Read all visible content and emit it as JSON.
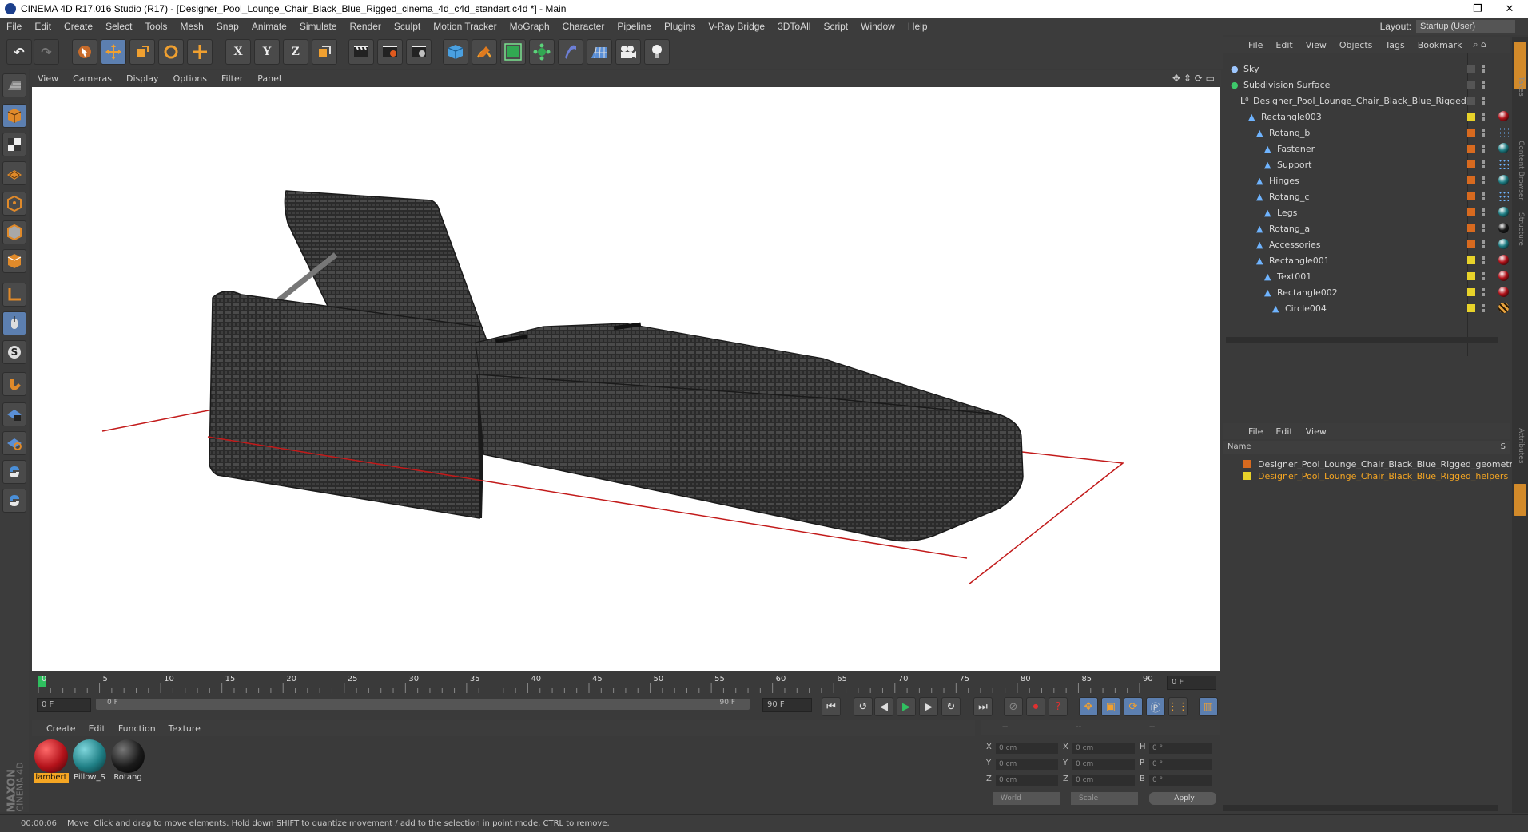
{
  "window": {
    "title": "CINEMA 4D R17.016 Studio (R17) - [Designer_Pool_Lounge_Chair_Black_Blue_Rigged_cinema_4d_c4d_standart.c4d *] - Main",
    "min_glyph": "—",
    "restore_glyph": "❐",
    "close_glyph": "✕"
  },
  "menubar": {
    "items": [
      "File",
      "Edit",
      "Create",
      "Select",
      "Tools",
      "Mesh",
      "Snap",
      "Animate",
      "Simulate",
      "Render",
      "Sculpt",
      "Motion Tracker",
      "MoGraph",
      "Character",
      "Pipeline",
      "Plugins",
      "V-Ray Bridge",
      "3DToAll",
      "Script",
      "Window",
      "Help"
    ],
    "layout_label": "Layout:",
    "layout_value": "Startup (User)"
  },
  "toolbar": {
    "undo_icon": "↶",
    "redo_icon": "↷",
    "x_label": "X",
    "y_label": "Y",
    "z_label": "Z"
  },
  "viewport_menu": {
    "items": [
      "View",
      "Cameras",
      "Display",
      "Options",
      "Filter",
      "Panel"
    ]
  },
  "timeline": {
    "ticks": [
      "0",
      "5",
      "10",
      "15",
      "20",
      "25",
      "30",
      "35",
      "40",
      "45",
      "50",
      "55",
      "60",
      "65",
      "70",
      "75",
      "80",
      "85",
      "90"
    ],
    "current_frame": "0 F",
    "start_field": "0 F",
    "range_start": "0 F",
    "range_end": "90 F",
    "end_field": "90 F"
  },
  "material_menu": {
    "items": [
      "Create",
      "Edit",
      "Function",
      "Texture"
    ]
  },
  "materials": [
    {
      "name": "lambert",
      "color": "#b3121a",
      "selected": true
    },
    {
      "name": "Pillow_S",
      "color": "#1f7f85",
      "selected": false
    },
    {
      "name": "Rotang",
      "color": "#1a1a1a",
      "selected": false
    }
  ],
  "coordinates": {
    "header": [
      "--",
      "--",
      "--"
    ],
    "rows": [
      {
        "a": "X",
        "av": "0 cm",
        "b": "X",
        "bv": "0 cm",
        "c": "H",
        "cv": "0 °"
      },
      {
        "a": "Y",
        "av": "0 cm",
        "b": "Y",
        "bv": "0 cm",
        "c": "P",
        "cv": "0 °"
      },
      {
        "a": "Z",
        "av": "0 cm",
        "b": "Z",
        "bv": "0 cm",
        "c": "B",
        "cv": "0 °"
      }
    ],
    "mode": "World",
    "type": "Scale",
    "apply": "Apply"
  },
  "object_manager": {
    "menu": [
      "File",
      "Edit",
      "View",
      "Objects",
      "Tags",
      "Bookmark"
    ],
    "objects": [
      {
        "name": "Sky",
        "level": 0,
        "layer": "",
        "tag": ""
      },
      {
        "name": "Subdivision Surface",
        "level": 0,
        "layer": "",
        "tag": ""
      },
      {
        "name": "Designer_Pool_Lounge_Chair_Black_Blue_Rigged",
        "level": 1,
        "layer": "",
        "tag": ""
      },
      {
        "name": "Rectangle003",
        "level": 2,
        "layer": "#e8d32a",
        "tag": "#b3121a"
      },
      {
        "name": "Rotang_b",
        "level": 3,
        "layer": "#d86a1f",
        "tag": "dots"
      },
      {
        "name": "Fastener",
        "level": 4,
        "layer": "#d86a1f",
        "tag": "#1f7f85"
      },
      {
        "name": "Support",
        "level": 4,
        "layer": "#d86a1f",
        "tag": "dots"
      },
      {
        "name": "Hinges",
        "level": 3,
        "layer": "#d86a1f",
        "tag": "#1f7f85"
      },
      {
        "name": "Rotang_c",
        "level": 3,
        "layer": "#d86a1f",
        "tag": "dots"
      },
      {
        "name": "Legs",
        "level": 4,
        "layer": "#d86a1f",
        "tag": "#1f7f85"
      },
      {
        "name": "Rotang_a",
        "level": 3,
        "layer": "#d86a1f",
        "tag": "#1a1a1a"
      },
      {
        "name": "Accessories",
        "level": 3,
        "layer": "#d86a1f",
        "tag": "#1f7f85"
      },
      {
        "name": "Rectangle001",
        "level": 3,
        "layer": "#e8d32a",
        "tag": "#b3121a"
      },
      {
        "name": "Text001",
        "level": 4,
        "layer": "#e8d32a",
        "tag": "#b3121a"
      },
      {
        "name": "Rectangle002",
        "level": 4,
        "layer": "#e8d32a",
        "tag": "#b3121a"
      },
      {
        "name": "Circle004",
        "level": 5,
        "layer": "#e8d32a",
        "tag": "stripe"
      }
    ]
  },
  "layer_manager": {
    "menu": [
      "File",
      "Edit",
      "View"
    ],
    "name_header": "Name",
    "s_header": "S",
    "layers": [
      {
        "name": "Designer_Pool_Lounge_Chair_Black_Blue_Rigged_geometry",
        "color": "#d86a1f",
        "text_color": "#d8d8d8"
      },
      {
        "name": "Designer_Pool_Lounge_Chair_Black_Blue_Rigged_helpers",
        "color": "#e8d32a",
        "text_color": "#f5a623"
      }
    ]
  },
  "side_tabs": [
    "Objects",
    "Takes",
    "Content Browser",
    "Structure",
    "Attributes",
    "Layers"
  ],
  "status": {
    "time": "00:00:06",
    "message": "Move: Click and drag to move elements. Hold down SHIFT to quantize movement / add to the selection in point mode, CTRL to remove."
  },
  "brand": {
    "line1": "MAXON",
    "line2": "CINEMA 4D"
  }
}
